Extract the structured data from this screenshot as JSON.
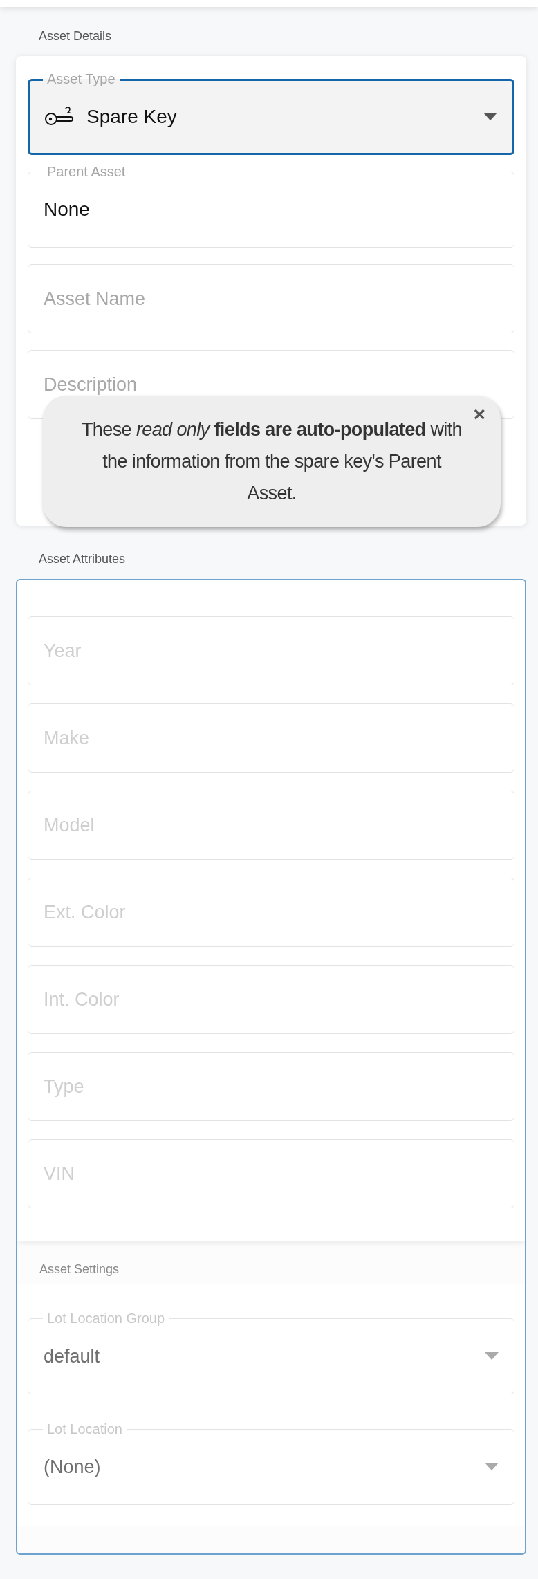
{
  "asset_details": {
    "title": "Asset Details",
    "fields": [
      {
        "kind": "select",
        "label": "Asset Type",
        "value": "Spare Key",
        "focused": true,
        "disabled": false
      },
      {
        "kind": "text",
        "label": "Parent Asset",
        "value": "None",
        "focused": false,
        "disabled": false
      },
      {
        "kind": "text",
        "placeholder": "Asset Name",
        "focused": false,
        "disabled": false
      },
      {
        "kind": "text",
        "placeholder": "Description",
        "focused": false,
        "disabled": false
      }
    ]
  },
  "tooltip": {
    "text": "These *read only* **fields are auto-populated** with the information from the spare key's Parent Asset.",
    "close": "×"
  },
  "asset_attributes": {
    "title": "Asset Attributes",
    "fields": [
      {
        "kind": "text",
        "placeholder": "Year",
        "focused": false,
        "disabled": true
      },
      {
        "kind": "text",
        "placeholder": "Make",
        "focused": false,
        "disabled": true
      },
      {
        "kind": "text",
        "placeholder": "Model",
        "focused": false,
        "disabled": true
      },
      {
        "kind": "text",
        "placeholder": "Ext. Color",
        "focused": false,
        "disabled": true
      },
      {
        "kind": "text",
        "placeholder": "Int. Color",
        "focused": false,
        "disabled": true
      },
      {
        "kind": "text",
        "placeholder": "Type",
        "focused": false,
        "disabled": true
      },
      {
        "kind": "text",
        "placeholder": "VIN",
        "focused": false,
        "disabled": true
      }
    ]
  },
  "asset_settings": {
    "title": "Asset Settings",
    "fields": [
      {
        "kind": "select",
        "label": "Lot Location Group",
        "value": "default",
        "focused": false,
        "disabled": true
      },
      {
        "kind": "select",
        "label": "Lot Location",
        "value": "(None)",
        "focused": false,
        "disabled": true
      }
    ]
  }
}
